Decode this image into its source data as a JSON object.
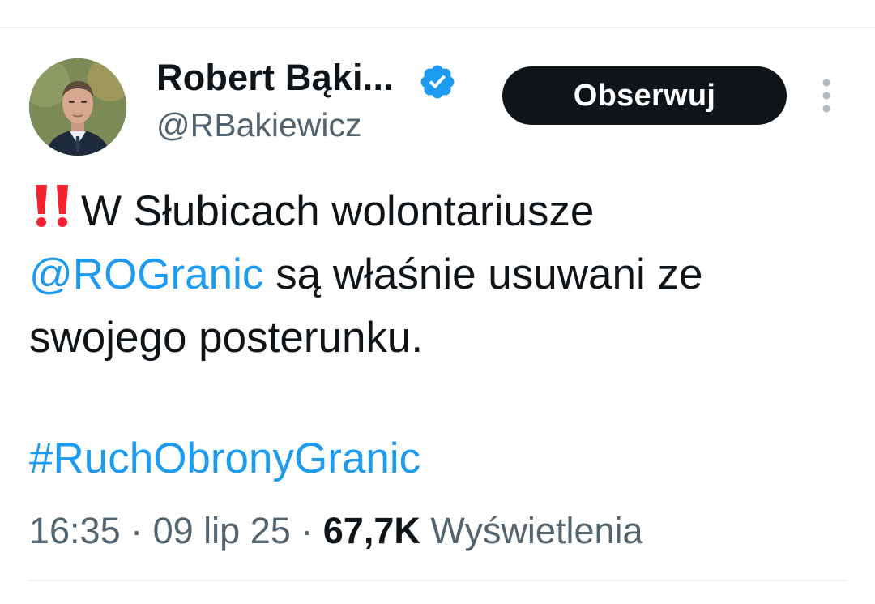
{
  "author": {
    "display_name": "Robert Bąki...",
    "handle": "@RBakiewicz",
    "verified_icon": "verified-badge-icon",
    "avatar": "profile-photo",
    "follow_label": "Obserwuj",
    "more_icon": "more-vertical-icon"
  },
  "tweet": {
    "emoji": "double-exclamation-icon",
    "line1_text": "W Słubicach wolontariusze",
    "mention": "@ROGranic",
    "line2_rest": " są właśnie usuwani ze",
    "line3_text": "swojego posterunku.",
    "hashtag": "#RuchObronyGranic"
  },
  "meta": {
    "time": "16:35",
    "separator": " · ",
    "date": "09 lip 25",
    "views_count": "67,7K",
    "views_label": " Wyświetlenia"
  },
  "colors": {
    "link": "#1d9bf0",
    "text": "#0f1419",
    "secondary": "#536471",
    "button_bg": "#0f1419",
    "emoji": "#f4212e"
  }
}
